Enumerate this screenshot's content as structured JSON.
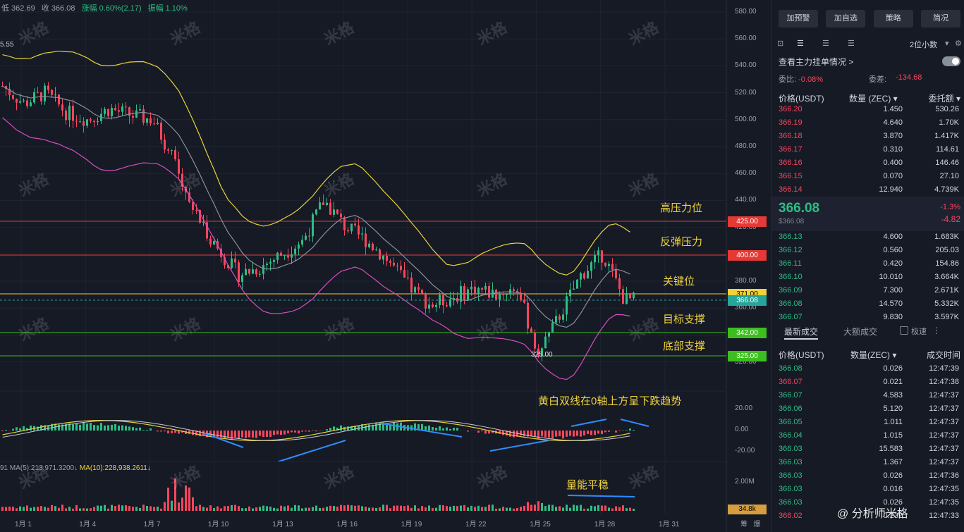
{
  "top_info": {
    "low": "低 362.69",
    "close": "收 366.08",
    "change": "涨幅 0.60%(2.17)",
    "amp": "振幅 1.10%"
  },
  "price_left": "5.55",
  "y_axis": [
    "580.00",
    "560.00",
    "540.00",
    "520.00",
    "500.00",
    "480.00",
    "460.00",
    "440.00",
    "420.00",
    "400.00",
    "380.00",
    "360.00",
    "340.00",
    "320.00"
  ],
  "x_axis": [
    "1月 1",
    "1月 4",
    "1月 7",
    "1月 10",
    "1月 13",
    "1月 16",
    "1月 19",
    "1月 22",
    "1月 25",
    "1月 28",
    "1月 31"
  ],
  "levels": [
    {
      "label": "高压力位",
      "tag": "425.00",
      "color": "#e53935"
    },
    {
      "label": "反弹压力",
      "tag": "400.00",
      "color": "#e53935"
    },
    {
      "label": "关键位",
      "tag": "371.00",
      "color": "#f0d23c"
    },
    {
      "label": "目标支撑",
      "tag": "342.00",
      "color": "#3cbf1e"
    },
    {
      "label": "底部支撑",
      "tag": "325.00",
      "color": "#3cbf1e"
    }
  ],
  "current_tag": "366.08",
  "low_marker": "325.00",
  "macd_note": "黄白双线在0轴上方呈下跌趋势",
  "macd_axis": [
    "20.00",
    "0.00",
    "-20.00"
  ],
  "vol_note": "量能平稳",
  "vol_line": {
    "prefix": "91",
    "ma5": "MA(5):213,971.3200↓",
    "ma10": "MA(10):228,938.2611↓"
  },
  "vol_axis": "2.00M",
  "vol_tag": "34.8k",
  "footer_right": [
    "筹",
    "爆"
  ],
  "watermark": "米格",
  "panel": {
    "buttons": [
      "加预警",
      "加自选",
      "策略",
      "简况"
    ],
    "decimals": "2位小数",
    "main_force": "查看主力挂单情况 >",
    "ratio_label": "委比:",
    "ratio_val": "-0.08%",
    "diff_label": "委差:",
    "diff_val": "-134.68",
    "headers": [
      "价格(USDT)",
      "数量 (ZEC)",
      "委托额"
    ],
    "asks": [
      [
        "366.20",
        "1.450",
        "530.26"
      ],
      [
        "366.19",
        "4.640",
        "1.70K"
      ],
      [
        "366.18",
        "3.870",
        "1.417K"
      ],
      [
        "366.17",
        "0.310",
        "114.61"
      ],
      [
        "366.16",
        "0.400",
        "146.46"
      ],
      [
        "366.15",
        "0.070",
        "27.10"
      ],
      [
        "366.14",
        "12.940",
        "4.739K"
      ]
    ],
    "last_price": "366.08",
    "last_sub": "$366.08",
    "last_pct": "-1.3%",
    "last_chg": "-4.82",
    "bids": [
      [
        "366.13",
        "4.600",
        "1.683K"
      ],
      [
        "366.12",
        "0.560",
        "205.03"
      ],
      [
        "366.11",
        "0.420",
        "154.86"
      ],
      [
        "366.10",
        "10.010",
        "3.664K"
      ],
      [
        "366.09",
        "7.300",
        "2.671K"
      ],
      [
        "366.08",
        "14.570",
        "5.332K"
      ],
      [
        "366.07",
        "9.830",
        "3.597K"
      ]
    ],
    "tab_latest": "最新成交",
    "tab_large": "大额成交",
    "tab_fast": "极速",
    "trade_headers": [
      "价格(USDT)",
      "数量(ZEC)",
      "成交时间"
    ],
    "trades": [
      [
        "366.08",
        "0.026",
        "12:47:39",
        "g"
      ],
      [
        "366.07",
        "0.021",
        "12:47:38",
        "r"
      ],
      [
        "366.07",
        "4.583",
        "12:47:37",
        "g"
      ],
      [
        "366.06",
        "5.120",
        "12:47:37",
        "g"
      ],
      [
        "366.05",
        "1.011",
        "12:47:37",
        "g"
      ],
      [
        "366.04",
        "1.015",
        "12:47:37",
        "g"
      ],
      [
        "366.03",
        "15.583",
        "12:47:37",
        "g"
      ],
      [
        "366.03",
        "1.367",
        "12:47:37",
        "g"
      ],
      [
        "366.03",
        "0.026",
        "12:47:36",
        "g"
      ],
      [
        "366.03",
        "0.016",
        "12:47:35",
        "g"
      ],
      [
        "366.03",
        "0.026",
        "12:47:35",
        "g"
      ],
      [
        "366.02",
        "0.232",
        "12:47:33",
        "r"
      ]
    ],
    "footer_brand": "@ 分析师米格"
  }
}
